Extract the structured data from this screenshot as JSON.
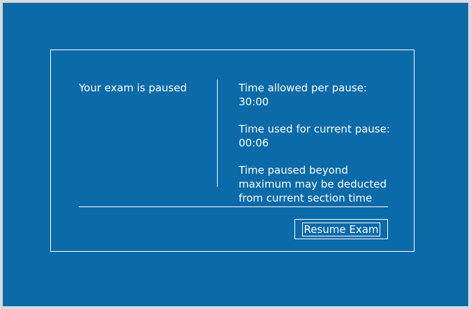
{
  "dialog": {
    "title": "Your exam is paused",
    "allowed": {
      "label": "Time allowed per pause:",
      "value": "30:00"
    },
    "used": {
      "label": "Time used for current pause:",
      "value": "00:06"
    },
    "warning": [
      "Time paused beyond",
      "maximum may be deducted",
      "from current section time"
    ],
    "resume_label": "Resume Exam"
  },
  "colors": {
    "background": "#0b6aa8",
    "frame": "#d9d9d9",
    "text": "#ffffff"
  }
}
